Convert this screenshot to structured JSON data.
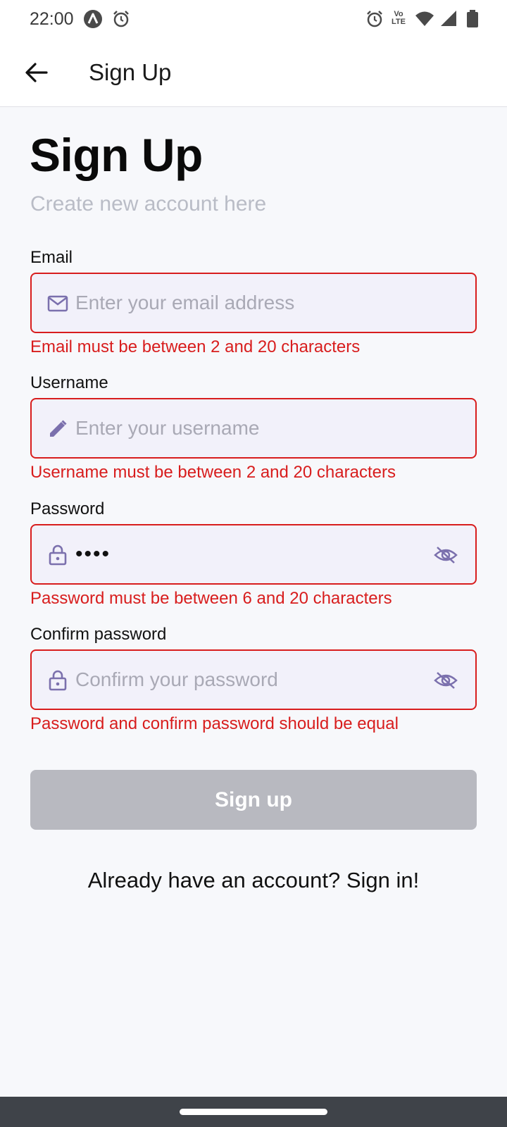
{
  "status_bar": {
    "time": "22:00",
    "left_icons": [
      "app-a-icon",
      "alarm-icon"
    ],
    "right_icons": [
      "alarm-icon",
      "volte-icon",
      "wifi-icon",
      "signal-icon",
      "battery-icon"
    ],
    "volte_text": "Vo LTE"
  },
  "app_bar": {
    "title": "Sign Up"
  },
  "header": {
    "title": "Sign Up",
    "subtitle": "Create new account here"
  },
  "form": {
    "email": {
      "label": "Email",
      "placeholder": "Enter your email address",
      "value": "",
      "error": "Email must be between 2 and 20 characters"
    },
    "username": {
      "label": "Username",
      "placeholder": "Enter your username",
      "value": "",
      "error": "Username must be between 2 and 20 characters"
    },
    "password": {
      "label": "Password",
      "placeholder": "",
      "value": "••••",
      "error": "Password must be between 6 and 20 characters"
    },
    "confirm_password": {
      "label": "Confirm password",
      "placeholder": "Confirm your password",
      "value": "",
      "error": "Password and confirm password should be equal"
    },
    "submit_label": "Sign up",
    "signin_text": "Already have an account? Sign in!"
  },
  "colors": {
    "error": "#d81d1d",
    "field_bg": "#f2f1fa",
    "icon_accent": "#7b70ad",
    "button_disabled": "#b8b9c0",
    "page_bg": "#f7f8fb"
  }
}
